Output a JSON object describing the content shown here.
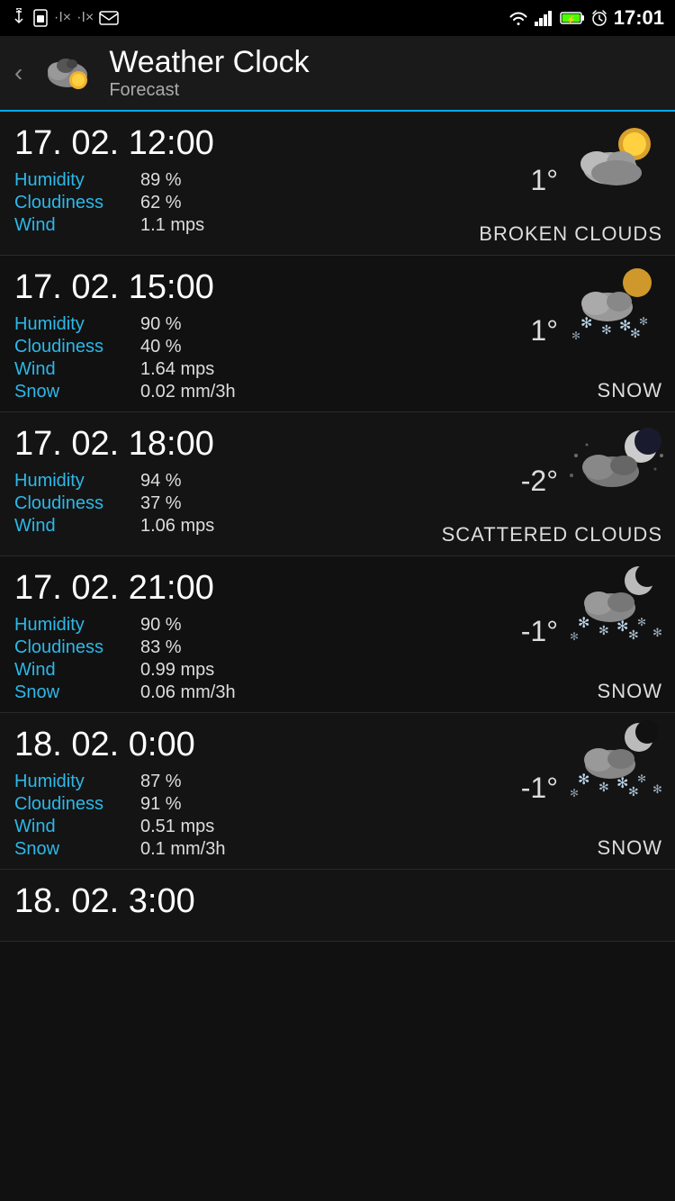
{
  "statusBar": {
    "time": "17:01",
    "leftIcons": [
      "usb",
      "sim",
      "signal-x1",
      "signal-x2",
      "email"
    ],
    "rightIcons": [
      "wifi",
      "signal",
      "battery",
      "alarm"
    ]
  },
  "header": {
    "title": "Weather Clock",
    "subtitle": "Forecast",
    "backArrow": "‹"
  },
  "forecasts": [
    {
      "datetime": "17. 02. 12:00",
      "humidity": "89 %",
      "cloudiness": "62 %",
      "wind": "1.1 mps",
      "snow": null,
      "temp": "1°",
      "condition": "BROKEN CLOUDS",
      "iconType": "broken-clouds-day"
    },
    {
      "datetime": "17. 02. 15:00",
      "humidity": "90 %",
      "cloudiness": "40 %",
      "wind": "1.64 mps",
      "snow": "0.02 mm/3h",
      "temp": "1°",
      "condition": "SNOW",
      "iconType": "snow-day"
    },
    {
      "datetime": "17. 02. 18:00",
      "humidity": "94 %",
      "cloudiness": "37 %",
      "wind": "1.06 mps",
      "snow": null,
      "temp": "-2°",
      "condition": "SCATTERED CLOUDS",
      "iconType": "scattered-clouds-night"
    },
    {
      "datetime": "17. 02. 21:00",
      "humidity": "90 %",
      "cloudiness": "83 %",
      "wind": "0.99 mps",
      "snow": "0.06 mm/3h",
      "temp": "-1°",
      "condition": "SNOW",
      "iconType": "snow-night"
    },
    {
      "datetime": "18. 02. 0:00",
      "humidity": "87 %",
      "cloudiness": "91 %",
      "wind": "0.51 mps",
      "snow": "0.1 mm/3h",
      "temp": "-1°",
      "condition": "SNOW",
      "iconType": "snow-night"
    },
    {
      "datetime": "18. 02. 3:00",
      "humidity": null,
      "cloudiness": null,
      "wind": null,
      "snow": null,
      "temp": "",
      "condition": "",
      "iconType": "snow-night"
    }
  ],
  "labels": {
    "humidity": "Humidity",
    "cloudiness": "Cloudiness",
    "wind": "Wind",
    "snow": "Snow"
  }
}
